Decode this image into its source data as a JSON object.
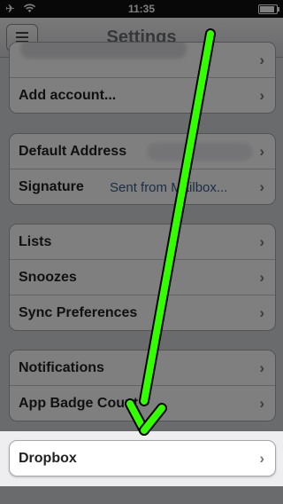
{
  "status_bar": {
    "time": "11:35"
  },
  "nav_bar": {
    "title": "Settings"
  },
  "groups": [
    {
      "rows": [
        {
          "label": "",
          "redacted": true
        },
        {
          "label": "Add account..."
        }
      ]
    },
    {
      "rows": [
        {
          "label": "Default Address",
          "value": "",
          "redacted": true
        },
        {
          "label": "Signature",
          "value": "Sent from Mailbox..."
        }
      ]
    },
    {
      "rows": [
        {
          "label": "Lists"
        },
        {
          "label": "Snoozes"
        },
        {
          "label": "Sync Preferences"
        }
      ]
    },
    {
      "rows": [
        {
          "label": "Notifications"
        },
        {
          "label": "App Badge Count"
        }
      ]
    }
  ],
  "highlighted_row": {
    "label": "Dropbox"
  },
  "arrow_color": "#33ff00"
}
